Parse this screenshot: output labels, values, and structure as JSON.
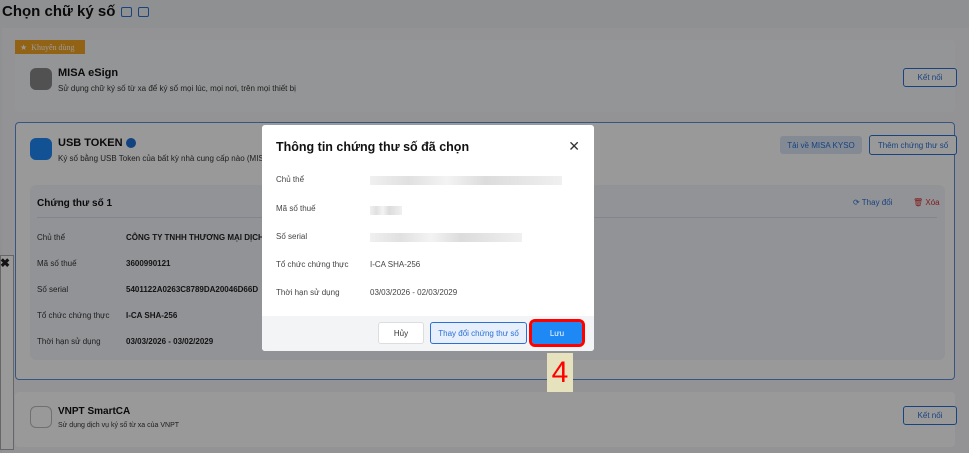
{
  "page": {
    "title": "Chọn chữ ký số"
  },
  "misa": {
    "badge": "Khuyên dùng",
    "name": "MISA eSign",
    "desc": "Sử dụng chữ ký số từ xa để ký số mọi lúc, mọi nơi, trên mọi thiết bị",
    "connect": "Kết nối"
  },
  "usb": {
    "name": "USB TOKEN",
    "desc": "Ký số bằng USB Token của bất kỳ nhà cung cấp nào (MISA,",
    "download": "Tải về MISA KYSO",
    "add": "Thêm chứng thư số",
    "cert": {
      "title": "Chứng thư số 1",
      "change": "Thay đổi",
      "delete": "Xóa",
      "rows": [
        {
          "label": "Chủ thể",
          "value": "CÔNG TY TNHH THƯƠNG MẠI DỊCH V"
        },
        {
          "label": "Mã số thuế",
          "value": "3600990121"
        },
        {
          "label": "Số serial",
          "value": "5401122A0263C8789DA20046D66D"
        },
        {
          "label": "Tổ chức chứng thực",
          "value": "I-CA SHA-256"
        },
        {
          "label": "Thời hạn sử dụng",
          "value": "03/03/2026 - 03/02/2029"
        }
      ]
    }
  },
  "vnpt": {
    "name": "VNPT SmartCA",
    "desc": "Sử dụng dịch vụ ký số từ xa của VNPT",
    "connect": "Kết nối"
  },
  "modal": {
    "title": "Thông tin chứng thư số đã chọn",
    "rows": [
      {
        "label": "Chủ thể",
        "value": ""
      },
      {
        "label": "Mã số thuế",
        "value": ""
      },
      {
        "label": "Số serial",
        "value": ""
      },
      {
        "label": "Tổ chức chứng thực",
        "value": "I-CA SHA-256"
      },
      {
        "label": "Thời hạn sử dụng",
        "value": "03/03/2026 - 02/03/2029"
      }
    ],
    "cancel": "Hủy",
    "change": "Thay đổi chứng thư số",
    "save": "Lưu"
  },
  "step": "4",
  "colors": {
    "accent": "#1e88f5",
    "highlight": "#ff0000"
  }
}
